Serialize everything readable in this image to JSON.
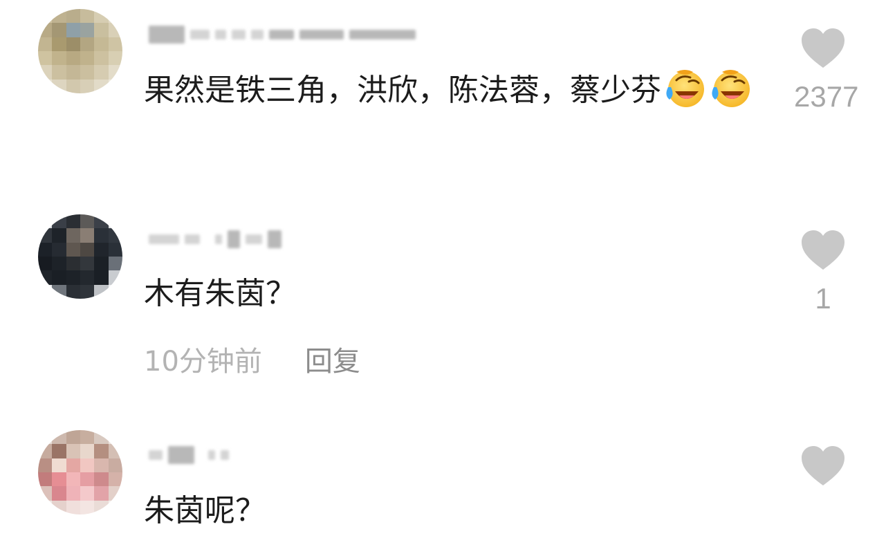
{
  "comments": [
    {
      "text": "果然是铁三角，洪欣，陈法蓉，蔡少芬",
      "emoji_count": 2,
      "emoji_name": "laughing-crying-emoji",
      "likes": "2377"
    },
    {
      "text": "木有朱茵？",
      "likes": "1",
      "time": "10分钟前",
      "reply_label": "回复"
    },
    {
      "text": "朱茵呢？"
    }
  ],
  "colors": {
    "text": "#1c1c1c",
    "like": "#a7a7a7",
    "heart": "#c8c8c8",
    "time": "#b3b3b3",
    "reply": "#8c8c8c"
  },
  "icons": {
    "like": "heart-icon",
    "avatar": "pixelated-avatar",
    "emoji": "laughing-crying-emoji"
  }
}
